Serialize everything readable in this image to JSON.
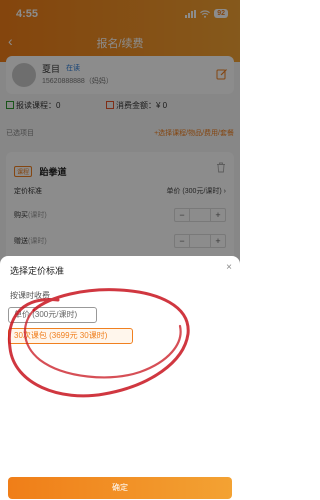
{
  "status_bar": {
    "time": "4:55",
    "battery": "92"
  },
  "nav": {
    "title": "报名/续费"
  },
  "user": {
    "name": "夏目",
    "tag": "在读",
    "phone": "15620888888（妈妈）"
  },
  "summary": {
    "course_label": "报读课程：0",
    "fee_label": "消费金额：¥ 0"
  },
  "selected": {
    "label": "已选项目",
    "add_link": "+选择课程/物品/费用/套餐"
  },
  "course": {
    "badge": "课程",
    "name": "跆拳道",
    "pricing_label": "定价标准",
    "pricing_value": "单价 (300元/课时)",
    "buy_label": "购买",
    "buy_unit": "(课时)",
    "gift_label": "赠送",
    "gift_unit": "(课时)",
    "buy_qty": "",
    "gift_qty": "",
    "minus": "−",
    "plus": "+"
  },
  "sheet": {
    "title": "选择定价标准",
    "close": "×",
    "section": "按课时收费",
    "options": [
      {
        "label": "单价 (300元/课时)",
        "selected": false
      },
      {
        "label": "30次课包 (3699元 30课时)",
        "selected": true
      }
    ],
    "confirm": "确定"
  },
  "colors": {
    "accent": "#f08020",
    "annotation": "#c8141e"
  },
  "icons": [
    "back-arrow-icon",
    "signal-icon",
    "wifi-icon",
    "battery-icon",
    "edit-icon",
    "trash-icon",
    "close-icon"
  ]
}
